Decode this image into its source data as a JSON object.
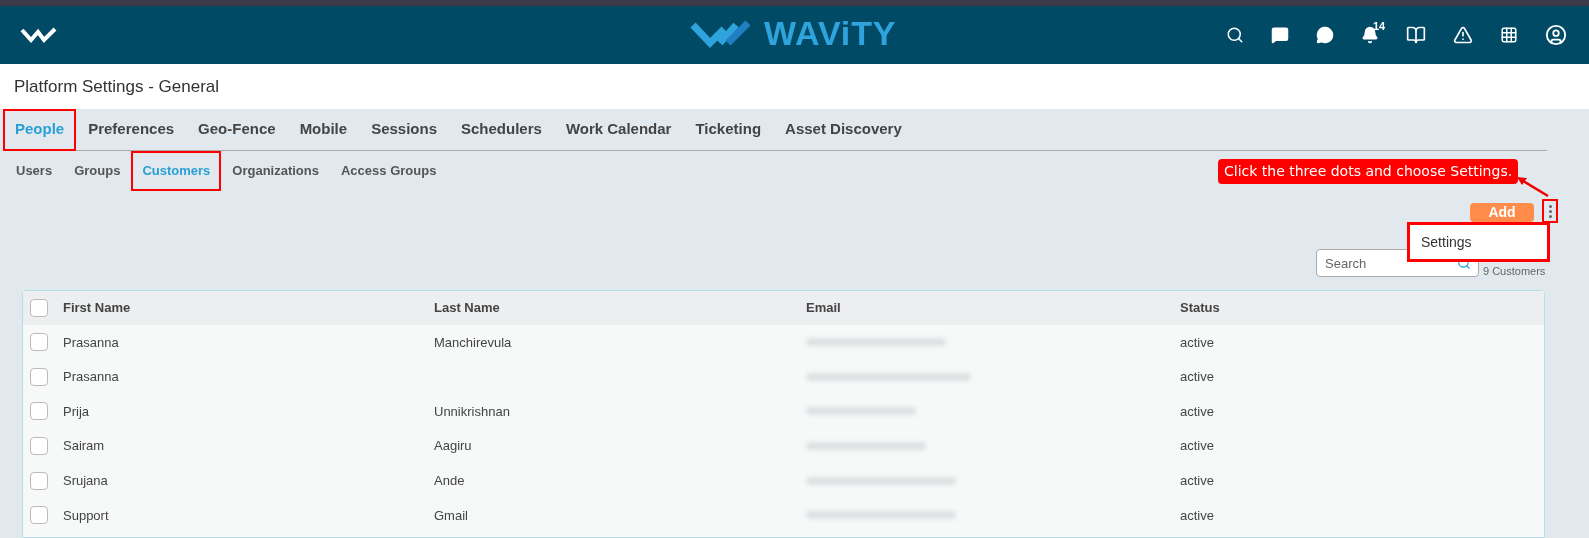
{
  "header": {
    "brand": "WAViTY",
    "notification_count": "14"
  },
  "page_title": "Platform Settings - General",
  "tabs": [
    {
      "label": "People",
      "selected": true,
      "highlighted": true
    },
    {
      "label": "Preferences",
      "selected": false,
      "highlighted": false
    },
    {
      "label": "Geo-Fence",
      "selected": false,
      "highlighted": false
    },
    {
      "label": "Mobile",
      "selected": false,
      "highlighted": false
    },
    {
      "label": "Sessions",
      "selected": false,
      "highlighted": false
    },
    {
      "label": "Schedulers",
      "selected": false,
      "highlighted": false
    },
    {
      "label": "Work Calendar",
      "selected": false,
      "highlighted": false
    },
    {
      "label": "Ticketing",
      "selected": false,
      "highlighted": false
    },
    {
      "label": "Asset Discovery",
      "selected": false,
      "highlighted": false
    }
  ],
  "subtabs": [
    {
      "label": "Users",
      "selected": false,
      "highlighted": false
    },
    {
      "label": "Groups",
      "selected": false,
      "highlighted": false
    },
    {
      "label": "Customers",
      "selected": true,
      "highlighted": true
    },
    {
      "label": "Organizations",
      "selected": false,
      "highlighted": false
    },
    {
      "label": "Access Groups",
      "selected": false,
      "highlighted": false
    }
  ],
  "callout": "Click the three dots and choose Settings.",
  "add_button": "Add",
  "menu": {
    "items": [
      "Settings"
    ]
  },
  "search": {
    "placeholder": "Search"
  },
  "count": "9 Customers",
  "table": {
    "select_all_checked": false,
    "columns": [
      "First Name",
      "Last Name",
      "Email",
      "Status"
    ],
    "rows": [
      {
        "first": "Prasanna",
        "last": "Manchirevula",
        "status": "active",
        "checked": false
      },
      {
        "first": "Prasanna",
        "status": "active",
        "checked": false
      },
      {
        "first": "Prija",
        "last": "Unnikrishnan",
        "status": "active",
        "checked": false
      },
      {
        "first": "Sairam",
        "last": "Aagiru",
        "status": "active",
        "checked": false
      },
      {
        "first": "Srujana",
        "last": "Ande",
        "status": "active",
        "checked": false
      },
      {
        "first": "Support",
        "last": "Gmail",
        "status": "active",
        "checked": false
      }
    ]
  }
}
